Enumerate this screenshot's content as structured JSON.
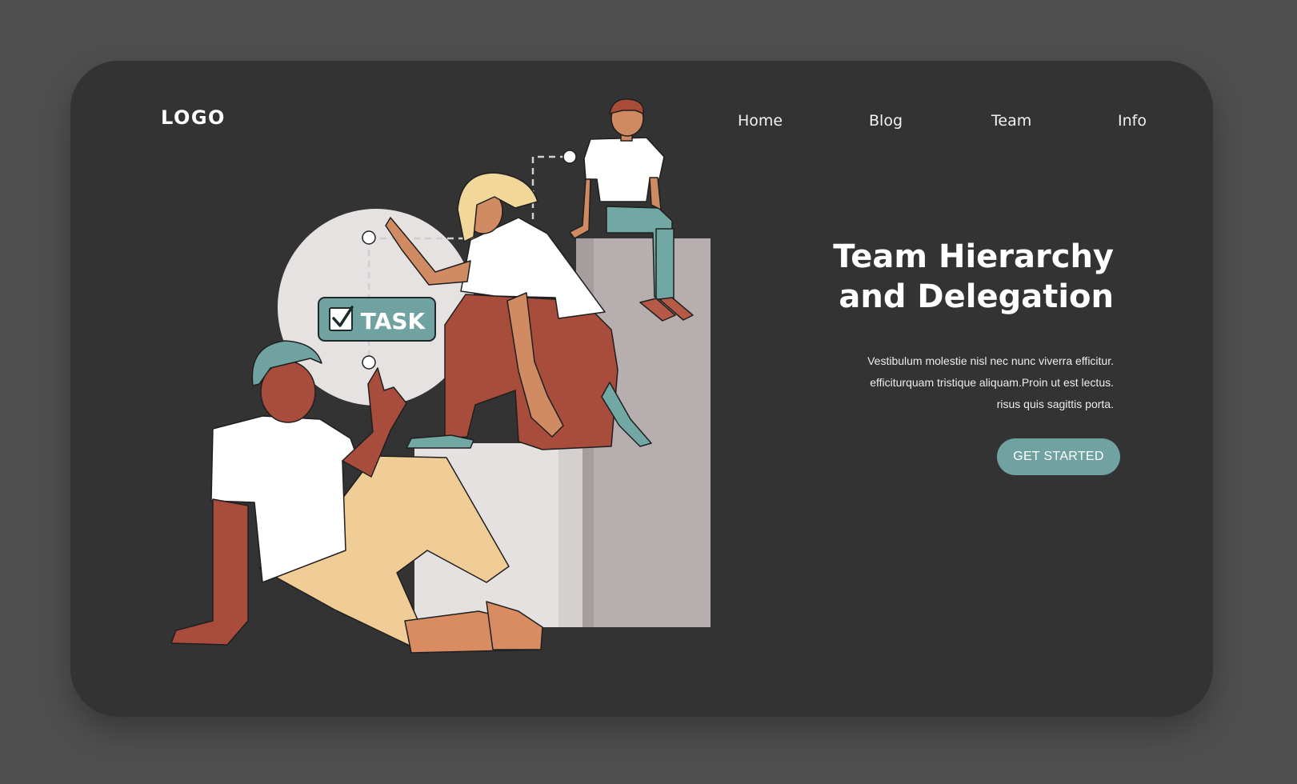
{
  "header": {
    "logo": "LOGO",
    "nav": [
      "Home",
      "Blog",
      "Team",
      "Info"
    ]
  },
  "illustration": {
    "task_badge_label": "TASK",
    "icons": [
      "checkbox-checked-icon"
    ]
  },
  "hero": {
    "title_lines": [
      "Team Hierarchy",
      "and Delegation"
    ],
    "description_lines": [
      "Vestibulum molestie nisl nec nunc viverra efficitur.",
      "efficiturquam tristique aliquam.Proin ut est lectus.",
      "risus quis sagittis porta."
    ],
    "cta_label": "GET STARTED"
  },
  "colors": {
    "page_background": "#4f4f4f",
    "card_background": "#333333",
    "accent_teal": "#6fa2a1",
    "text_white": "#ffffff"
  }
}
